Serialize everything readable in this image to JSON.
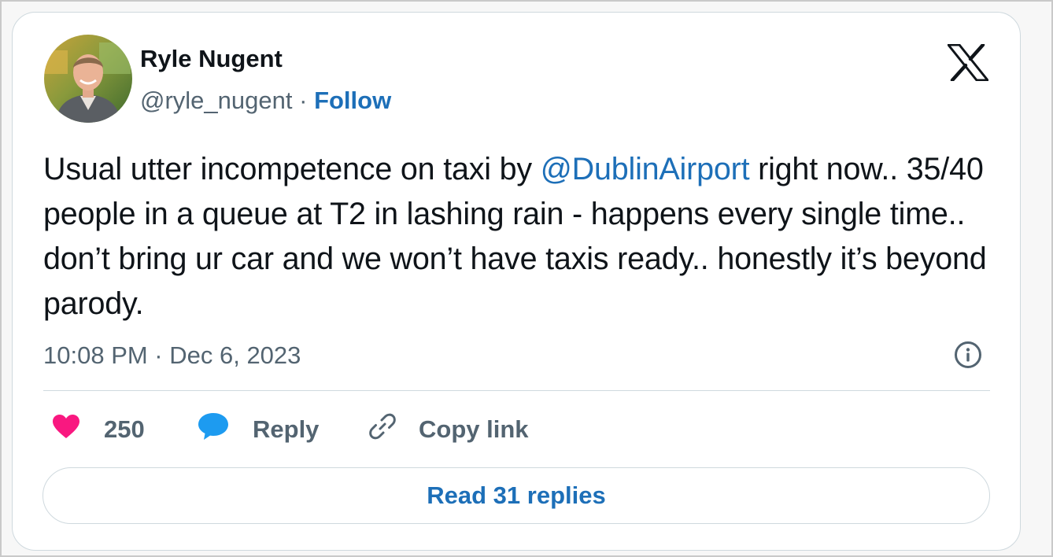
{
  "author": {
    "name": "Ryle Nugent",
    "handle": "@ryle_nugent",
    "separator": "·",
    "follow_label": "Follow"
  },
  "tweet": {
    "text_part1": "Usual utter incompetence on taxi by ",
    "mention": "@DublinAirport",
    "text_part2": " right now.. 35/40 people in a queue at T2 in lashing rain - happens every single time.. don’t bring ur car and we won’t have taxis ready.. honestly it’s beyond parody.",
    "timestamp": "10:08 PM · Dec 6, 2023"
  },
  "actions": {
    "like_count": "250",
    "reply_label": "Reply",
    "copy_link_label": "Copy link"
  },
  "read_replies_label": "Read 31 replies",
  "icons": {
    "platform": "x-logo-icon",
    "like": "heart-icon",
    "reply": "speech-bubble-icon",
    "copy": "link-icon",
    "info": "info-icon"
  },
  "colors": {
    "link": "#1d6fb8",
    "heart": "#f91880",
    "reply_bubble": "#1d9bf0",
    "text": "#0f1419",
    "muted": "#536471",
    "border": "#cfd9de"
  }
}
